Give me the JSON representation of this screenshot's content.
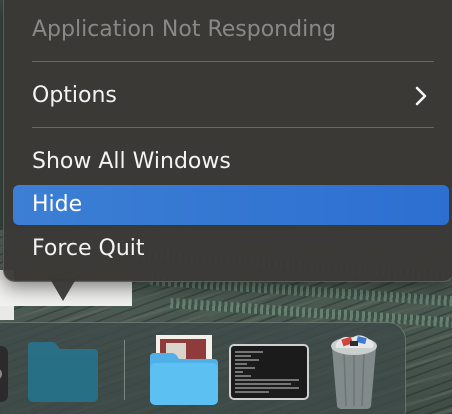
{
  "menu": {
    "items": [
      {
        "label": "Application Not Responding",
        "enabled": false
      },
      {
        "label": "Options",
        "has_submenu": true
      },
      {
        "label": "Show All Windows"
      },
      {
        "label": "Hide",
        "selected": true
      },
      {
        "label": "Force Quit"
      }
    ]
  },
  "colors": {
    "selection": "#2f74d6",
    "menu_background": "#3a3836",
    "disabled_text": "#8a8886",
    "text": "#f3f3f3"
  },
  "dock": {
    "icons": [
      "app-icon-partial",
      "folder-icon",
      "folder-with-image-icon",
      "terminal-icon",
      "trash-full-icon"
    ]
  }
}
